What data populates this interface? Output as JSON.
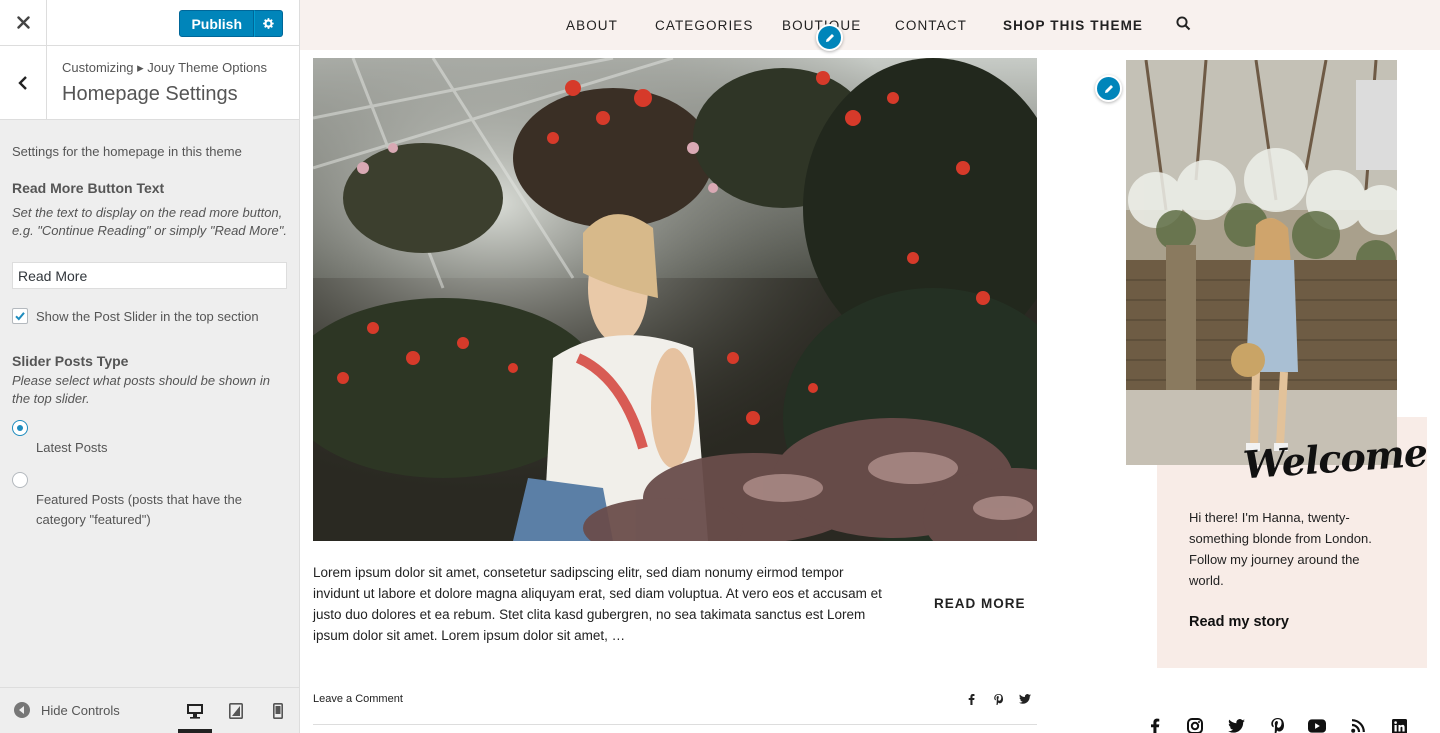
{
  "customizer": {
    "close_icon": "close-icon",
    "publish_label": "Publish",
    "breadcrumb": "Customizing ▸ Jouy Theme Options",
    "section_title": "Homepage Settings",
    "intro": "Settings for the homepage in this theme",
    "read_more": {
      "title": "Read More Button Text",
      "description": "Set the text to display on the read more button, e.g. \"Continue Reading\" or simply \"Read More\".",
      "value": "Read More"
    },
    "slider_checkbox": {
      "label": "Show the Post Slider in the top section",
      "checked": true
    },
    "slider_type": {
      "title": "Slider Posts Type",
      "description": "Please select what posts should be shown in the top slider.",
      "options": [
        {
          "label": "Latest Posts",
          "checked": true
        },
        {
          "label": "Featured Posts (posts that have the category \"featured\")",
          "checked": false
        }
      ]
    },
    "footer": {
      "hide_controls": "Hide Controls",
      "active_device": "desktop"
    },
    "accent_color": "#0085ba"
  },
  "site": {
    "nav": [
      "ABOUT",
      "CATEGORIES",
      "BOUTIQUE",
      "CONTACT",
      "SHOP THIS THEME"
    ],
    "post": {
      "excerpt": "Lorem ipsum dolor sit amet, consetetur sadipscing elitr, sed diam nonumy eirmod tempor invidunt ut labore et dolore magna aliquyam erat, sed diam voluptua. At vero eos et accusam et justo duo dolores et ea rebum. Stet clita kasd gubergren, no sea takimata sanctus est Lorem ipsum dolor sit amet. Lorem ipsum dolor sit amet, …",
      "read_more": "READ MORE",
      "comment_link": "Leave a Comment",
      "share_icons": [
        "facebook-icon",
        "pinterest-icon",
        "twitter-icon"
      ]
    },
    "about": {
      "heading": "Welcome",
      "text": "Hi there! I'm Hanna, twenty-something blonde from London. Follow my journey around the world.",
      "link": "Read my story"
    },
    "social_icons": [
      "facebook-icon",
      "instagram-icon",
      "twitter-icon",
      "pinterest-icon",
      "youtube-icon",
      "rss-icon",
      "linkedin-icon"
    ],
    "nav_background": "#f8f1ee",
    "about_background": "#f8ece7"
  }
}
